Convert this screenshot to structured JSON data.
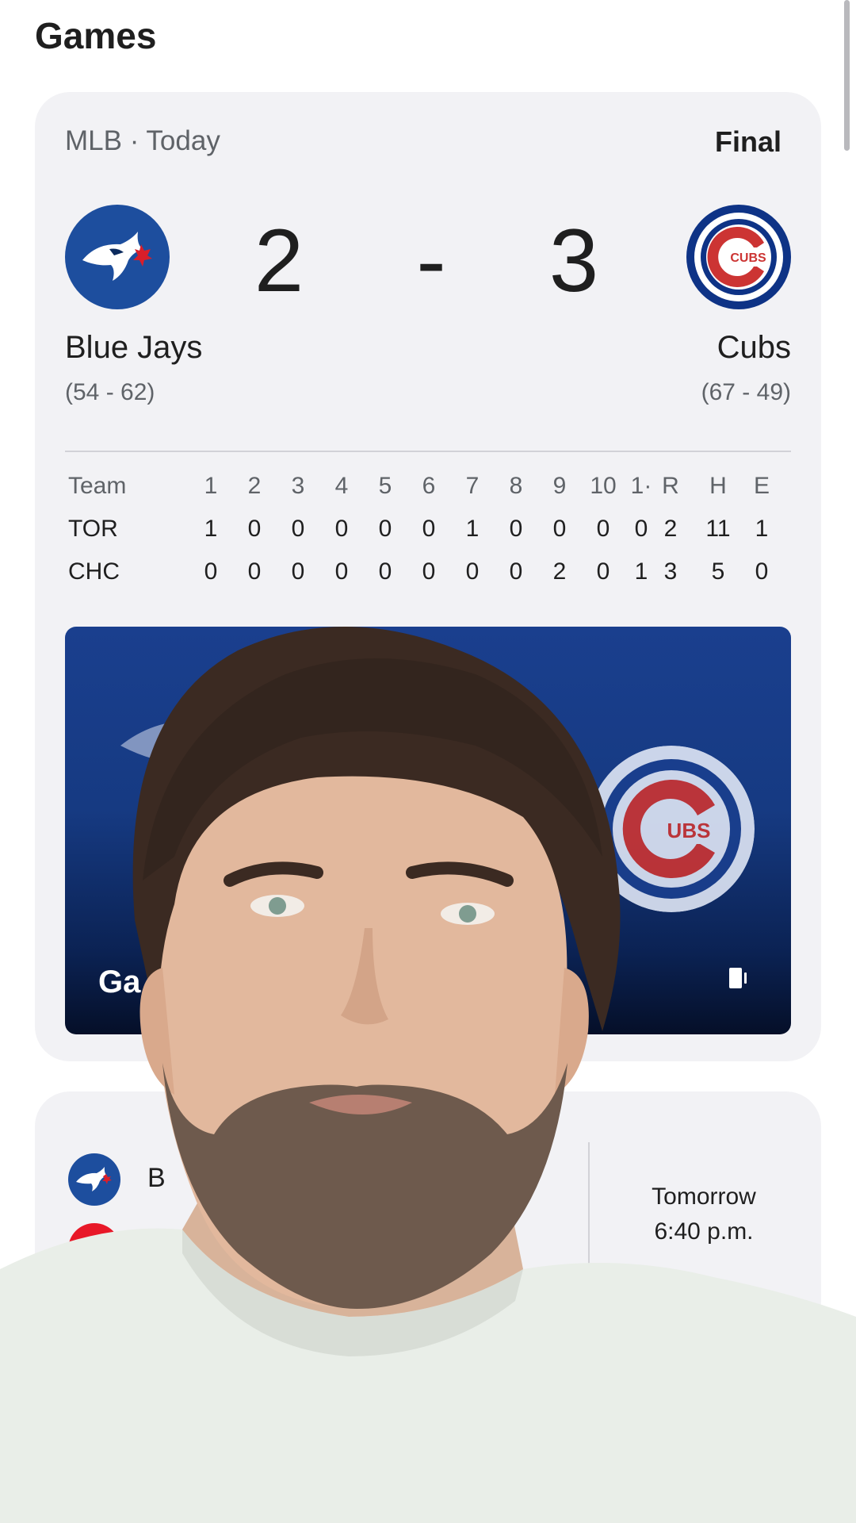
{
  "header": {
    "title": "Games"
  },
  "game": {
    "league_date": "MLB · Today",
    "status": "Final",
    "away": {
      "name": "Blue Jays",
      "record": "(54 - 62)",
      "score": "2",
      "logo": "blue-jays-logo"
    },
    "home": {
      "name": "Cubs",
      "record": "(67 - 49)",
      "score": "3",
      "logo": "cubs-logo"
    },
    "dash": "-",
    "linescore": {
      "team_header": "Team",
      "columns": [
        "1",
        "2",
        "3",
        "4",
        "5",
        "6",
        "7",
        "8",
        "9",
        "10",
        "1·",
        "R",
        "H",
        "E"
      ],
      "rows": [
        {
          "team": "TOR",
          "values": [
            "1",
            "0",
            "0",
            "0",
            "0",
            "0",
            "1",
            "0",
            "0",
            "0",
            "0",
            "2",
            "11",
            "1"
          ]
        },
        {
          "team": "CHC",
          "values": [
            "0",
            "0",
            "0",
            "0",
            "0",
            "0",
            "0",
            "0",
            "2",
            "0",
            "1",
            "3",
            "5",
            "0"
          ]
        }
      ]
    },
    "video": {
      "title": "Ga",
      "icon": "video-orientation-icon"
    }
  },
  "upcoming": {
    "team1": {
      "name": "B",
      "logo": "blue-jays-logo"
    },
    "team2": {
      "name": "",
      "logo": "phillies-logo"
    },
    "time_day": "Tomorrow",
    "time_clock": "6:40 p.m."
  },
  "colors": {
    "card": "#f2f2f5",
    "jays_blue": "#1d4e9e",
    "cubs_blue": "#0e3386",
    "cubs_red": "#cc3433",
    "phillies_red": "#e81828"
  }
}
